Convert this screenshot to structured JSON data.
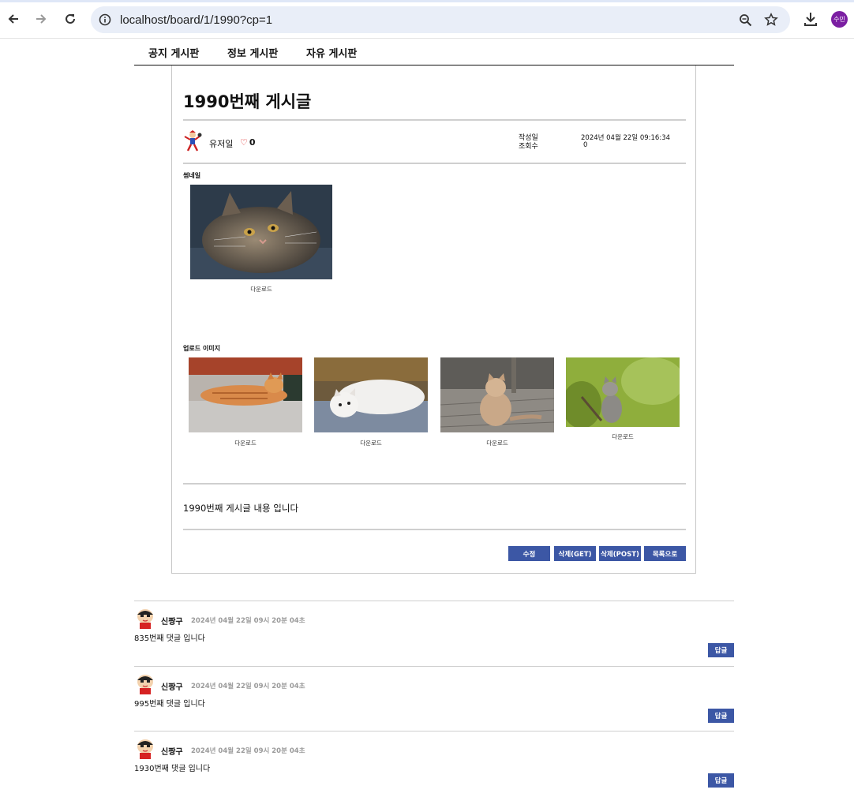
{
  "browser": {
    "url": "localhost/board/1/1990?cp=1",
    "profile_label": "수민",
    "icons": [
      "back-icon",
      "forward-icon",
      "reload-icon",
      "info-icon",
      "zoom-icon",
      "star-icon",
      "download-icon"
    ]
  },
  "nav": {
    "items": [
      "공지 게시판",
      "정보 게시판",
      "자유 게시판"
    ]
  },
  "article": {
    "title": "1990번째 게시글",
    "author": "유저일",
    "like_icon": "heart-icon",
    "like_count": "0",
    "created_label": "작성일",
    "created_value": "2024년 04월 22일 09:16:34",
    "views_label": "조회수",
    "views_value": "0",
    "thumbnail_label": "썸네일",
    "thumbnail_download": "다운로드",
    "upload_label": "업로드 이미지",
    "uploads": [
      {
        "download": "다운로드"
      },
      {
        "download": "다운로드"
      },
      {
        "download": "다운로드"
      },
      {
        "download": "다운로드"
      }
    ],
    "content": "1990번째 게시글 내용 입니다",
    "buttons": {
      "edit": "수정",
      "delete_get": "삭제(GET)",
      "delete_post": "삭제(POST)",
      "list": "목록으로"
    }
  },
  "comments": [
    {
      "name": "신짱구",
      "date": "2024년 04월 22일 09시 20분 04초",
      "text": "835번째 댓글 입니다",
      "reply": "답글"
    },
    {
      "name": "신짱구",
      "date": "2024년 04월 22일 09시 20분 04초",
      "text": "995번째 댓글 입니다",
      "reply": "답글"
    },
    {
      "name": "신짱구",
      "date": "2024년 04월 22일 09시 20분 04초",
      "text": "1930번째 댓글 입니다",
      "reply": "답글"
    }
  ],
  "colors": {
    "button_blue": "#3c57a5",
    "accent_purple": "#7b1fa2"
  }
}
